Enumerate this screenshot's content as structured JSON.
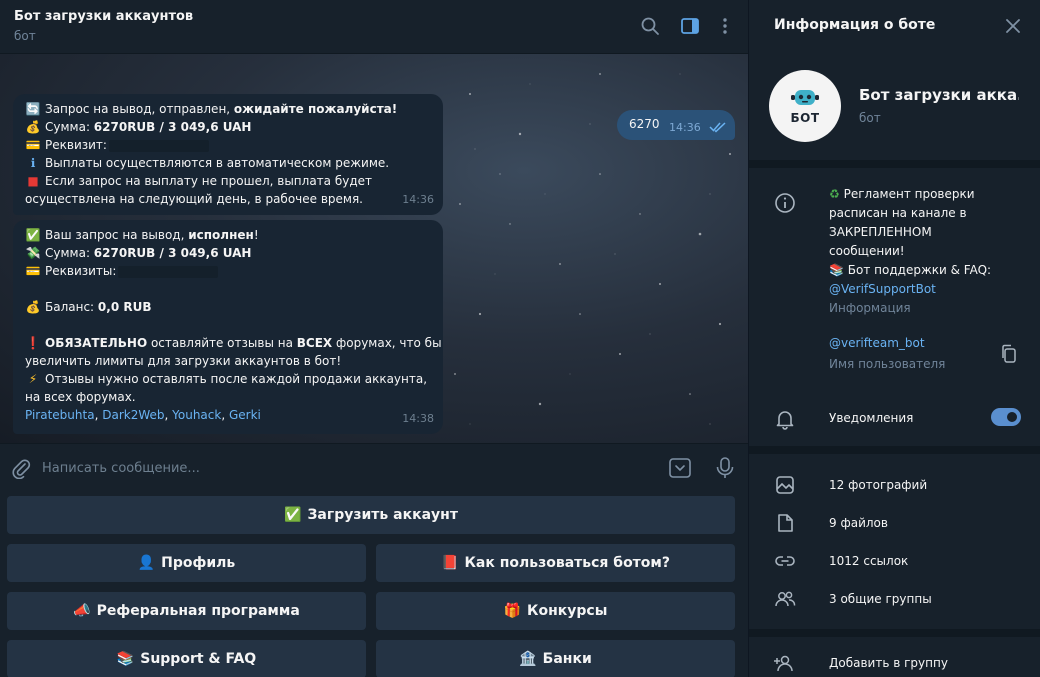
{
  "chat": {
    "title": "Бот загрузки аккаунтов",
    "subtitle": "бот",
    "outgoing": {
      "text": "6270",
      "time": "14:36"
    },
    "msg1": {
      "line1_a": "Запрос на вывод,  отправлен, ",
      "line1_b": "ожидайте пожалуйста!",
      "line2_a": "Сумма: ",
      "line2_b": "6270RUB  / 3 049,6 UAH",
      "line3": "Реквизит:",
      "line4": "Выплаты осуществляются в автоматическом режиме.",
      "line5": "Если запрос на выплату не прошел, выплата будет",
      "line6": "осуществлена на следующий день, в рабочее время.",
      "time": "14:36"
    },
    "msg2": {
      "line1_a": "Ваш запрос на вывод, ",
      "line1_b": "исполнен",
      "line1_c": "!",
      "line2_a": "Сумма: ",
      "line2_b": "6270RUB  / 3 049,6 UAH",
      "line3": "Реквизиты:",
      "line4_a": "Баланс: ",
      "line4_b": "0,0 RUB",
      "line5_a": "ОБЯЗАТЕЛЬНО",
      "line5_b": " оставляйте отзывы на ",
      "line5_c": "ВСЕХ",
      "line5_d": " форумах, что бы",
      "line6": "увеличить лимиты для загрузки аккаунтов в бот!",
      "line7": "Отзывы нужно оставлять после каждой продажи аккаунта,",
      "line8": "на всех форумах.",
      "links": [
        "Piratebuhta",
        "Dark2Web",
        "Youhack",
        "Gerki"
      ],
      "time": "14:38"
    },
    "composer_placeholder": "Написать сообщение..."
  },
  "keyboard": {
    "upload": "Загрузить аккаунт",
    "profile": "Профиль",
    "howto": "Как пользоваться ботом?",
    "referral": "Реферальная программа",
    "contests": "Конкурсы",
    "support": "Support & FAQ",
    "banks": "Банки"
  },
  "info": {
    "title": "Информация о боте",
    "name": "Бот загрузки акка...",
    "sub": "бот",
    "avatar_text": "БОТ",
    "desc_line1": "Регламент проверки",
    "desc_line2": "расписан на канале в",
    "desc_line3": "ЗАКРЕПЛЕННОМ",
    "desc_line4": "сообщении!",
    "desc_line5": "Бот поддержки & FAQ:",
    "desc_link": "@VerifSupportBot",
    "desc_caption": "Информация",
    "username": "@verifteam_bot",
    "username_caption": "Имя пользователя",
    "notifications": "Уведомления",
    "notifications_on": true,
    "photos": "12 фотографий",
    "files": "9 файлов",
    "links": "1012 ссылок",
    "groups": "3 общие группы",
    "add_group": "Добавить в группу"
  },
  "colors": {
    "accent": "#6ab3f3",
    "outgoing_bubble": "#2b5278",
    "incoming_bubble": "#182533",
    "background": "#17212b"
  }
}
